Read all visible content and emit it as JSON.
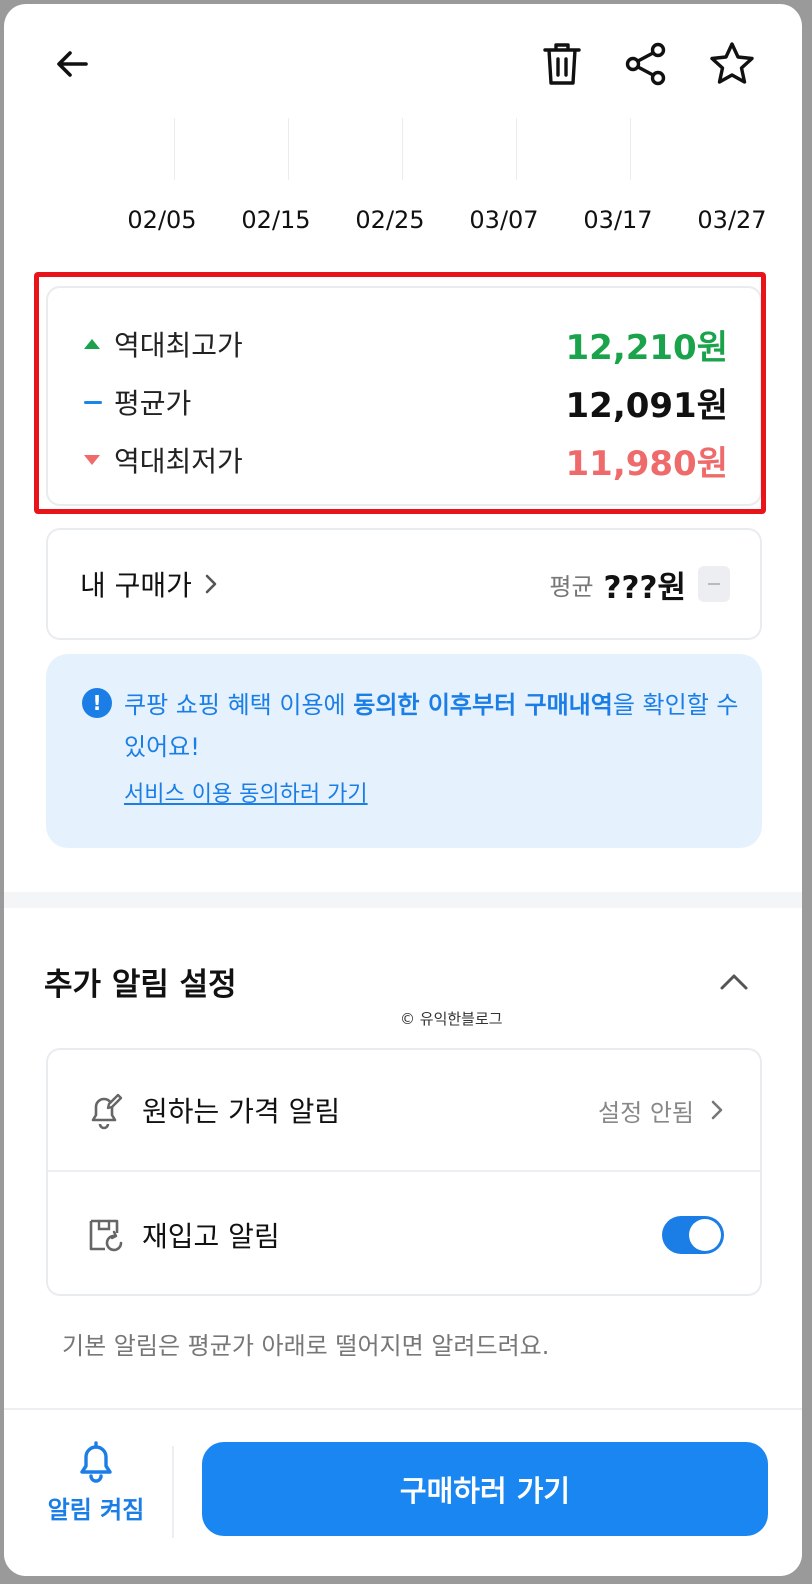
{
  "header": {
    "back_icon": "arrow-left-icon",
    "actions": [
      "trash-icon",
      "share-icon",
      "star-icon"
    ]
  },
  "chart": {
    "x_ticks": [
      "02/05",
      "02/15",
      "02/25",
      "03/07",
      "03/17",
      "03/27"
    ]
  },
  "price_summary": {
    "rows": [
      {
        "label": "역대최고가",
        "value": "12,210원",
        "marker": "triangle-up",
        "color": "#1aa34a"
      },
      {
        "label": "평균가",
        "value": "12,091원",
        "marker": "dash",
        "color": "#111111"
      },
      {
        "label": "역대최저가",
        "value": "11,980원",
        "marker": "triangle-down",
        "color": "#ef6a6a"
      }
    ],
    "highlight_color": "#e8141a"
  },
  "my_purchase": {
    "label": "내 구매가",
    "avg_label": "평균",
    "avg_value": "???원"
  },
  "notice": {
    "text_pre": "쿠팡 쇼핑 혜택 이용에 ",
    "text_bold": "동의한 이후부터 구매내역",
    "text_post": "을 확인할 수 있어요!",
    "link": "서비스 이용 동의하러 가기"
  },
  "alerts": {
    "title": "추가 알림 설정",
    "watermark": "© 유익한블로그",
    "items": [
      {
        "label": "원하는 가격 알림",
        "status": "설정 안됨",
        "icon": "bell-edit-icon"
      },
      {
        "label": "재입고 알림",
        "toggle_on": true,
        "icon": "restock-box-icon"
      }
    ],
    "footnote": "기본 알림은 평균가 아래로 떨어지면 알려드려요."
  },
  "bottom": {
    "bell_label": "알림 켜짐",
    "buy_label": "구매하러 가기",
    "accent": "#1a86f2"
  }
}
